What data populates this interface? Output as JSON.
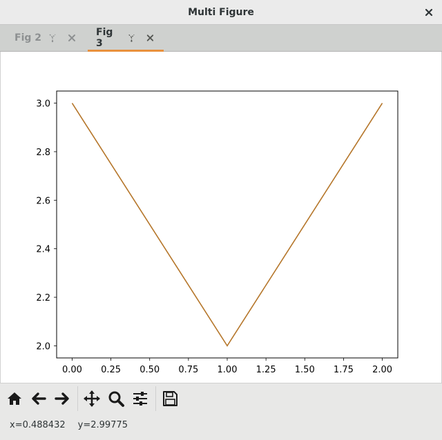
{
  "window": {
    "title": "Multi Figure"
  },
  "tabs": [
    {
      "label": "Fig 2",
      "active": false
    },
    {
      "label": "Fig 3",
      "active": true
    }
  ],
  "colors": {
    "line": "#b5762a",
    "tab_active_underline": "#e8903d"
  },
  "toolbar": {
    "icons": [
      "home-icon",
      "back-icon",
      "forward-icon",
      "pan-icon",
      "zoom-icon",
      "configure-subplots-icon",
      "save-icon"
    ]
  },
  "status": {
    "x": "x=0.488432",
    "y": "y=2.99775"
  },
  "chart_data": {
    "type": "line",
    "title": "",
    "xlabel": "",
    "ylabel": "",
    "x": [
      0,
      1,
      2
    ],
    "series": [
      {
        "values": [
          3.0,
          2.0,
          3.0
        ]
      }
    ],
    "xlim": [
      -0.1,
      2.1
    ],
    "ylim": [
      1.95,
      3.05
    ],
    "xticks": [
      "0.00",
      "0.25",
      "0.50",
      "0.75",
      "1.00",
      "1.25",
      "1.50",
      "1.75",
      "2.00"
    ],
    "yticks": [
      "2.0",
      "2.2",
      "2.4",
      "2.6",
      "2.8",
      "3.0"
    ],
    "grid": false
  }
}
